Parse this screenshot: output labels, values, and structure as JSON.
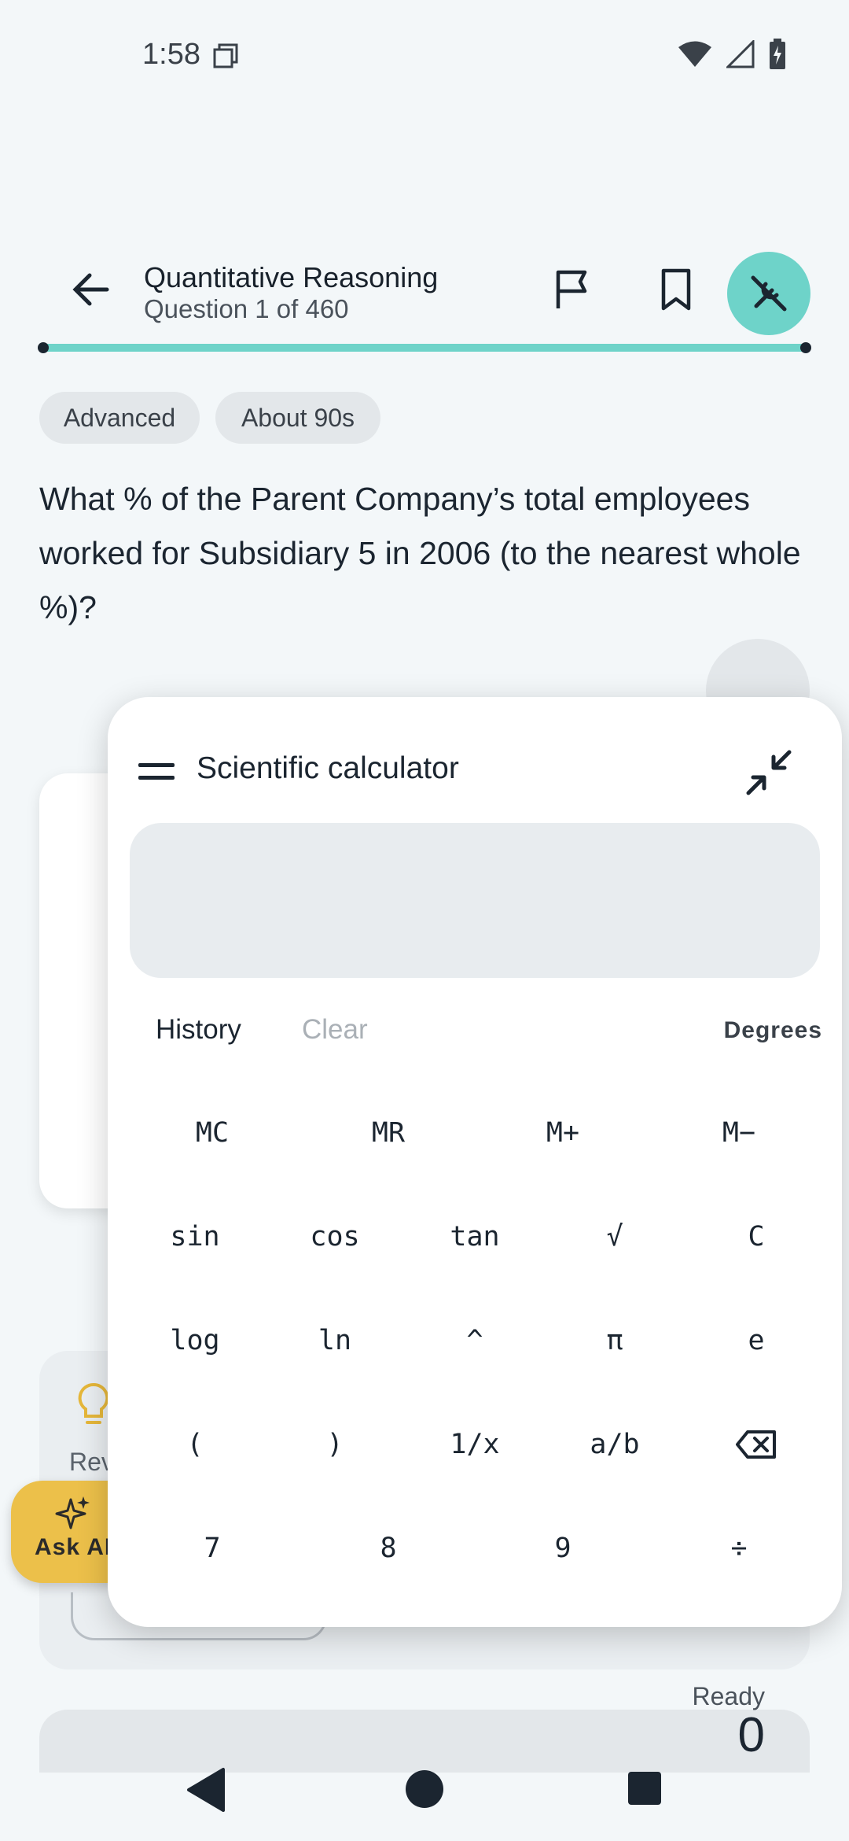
{
  "status_bar": {
    "time": "1:58"
  },
  "header": {
    "title": "Quantitative Reasoning",
    "subtitle": "Question 1 of 460",
    "accent_color": "#6ed3c9"
  },
  "chips": {
    "difficulty": "Advanced",
    "time": "About 90s"
  },
  "question": {
    "text": "What % of the Parent Company’s total employees worked for Subsidiary 5 in 2006 (to the nearest whole %)?"
  },
  "hint": {
    "label_partial": "Rev"
  },
  "ask_ai": {
    "label": "Ask AI"
  },
  "calculator": {
    "title": "Scientific calculator",
    "status": "Ready",
    "value": "0",
    "history_label": "History",
    "clear_label": "Clear",
    "angle_mode": "Degrees",
    "memory_keys": [
      "MC",
      "MR",
      "M+",
      "M−"
    ],
    "rows": [
      [
        "sin",
        "cos",
        "tan",
        "√",
        "C"
      ],
      [
        "log",
        "ln",
        "^",
        "π",
        "e"
      ],
      [
        "(",
        ")",
        "1/x",
        "a/b",
        "backspace-icon"
      ],
      [
        "7",
        "8",
        "9",
        "÷"
      ]
    ]
  }
}
